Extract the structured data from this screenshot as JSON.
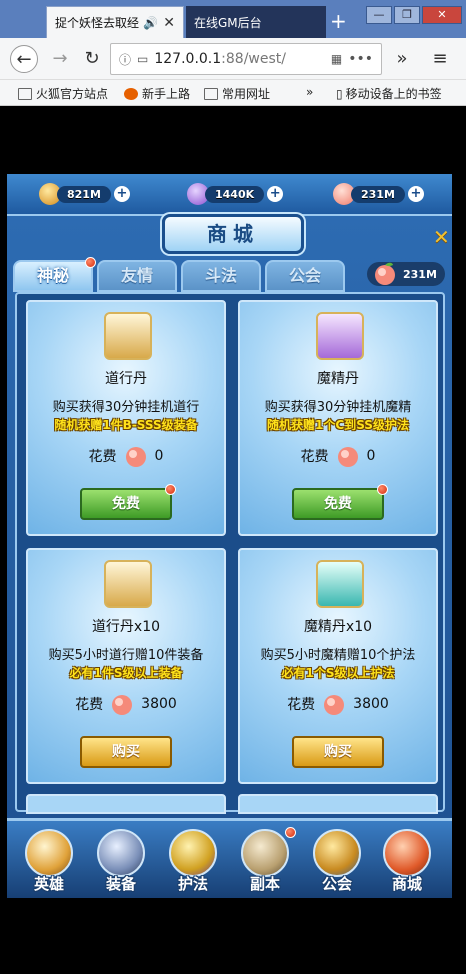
{
  "browser": {
    "tabs": [
      {
        "title": "捉个妖怪去取经"
      },
      {
        "title": "在线GM后台"
      }
    ],
    "address": {
      "host": "127.0.0.1",
      "path": ":88/west/"
    },
    "bookmarks": [
      "火狐官方站点",
      "新手上路",
      "常用网址",
      "移动设备上的书签"
    ]
  },
  "game": {
    "resources": [
      {
        "icon": "gold-ingot-icon",
        "value": "821M"
      },
      {
        "icon": "crystal-icon",
        "value": "1440K"
      },
      {
        "icon": "peach-icon",
        "value": "231M"
      }
    ],
    "shop_title": "商城",
    "shop_currency": "231M",
    "tabs": [
      "神秘",
      "友情",
      "斗法",
      "公会"
    ],
    "cards": [
      {
        "name": "道行丹",
        "desc": "购买获得30分钟挂机道行",
        "bonus": "随机获赠1件B-SSS级装备",
        "cost_label": "花费",
        "cost": "0",
        "button": "免费"
      },
      {
        "name": "魔精丹",
        "desc": "购买获得30分钟挂机魔精",
        "bonus": "随机获赠1个C到SS级护法",
        "cost_label": "花费",
        "cost": "0",
        "button": "免费"
      },
      {
        "name": "道行丹x10",
        "desc": "购买5小时道行赠10件装备",
        "bonus": "必有1件S级以上装备",
        "cost_label": "花费",
        "cost": "3800",
        "button": "购买"
      },
      {
        "name": "魔精丹x10",
        "desc": "购买5小时魔精赠10个护法",
        "bonus": "必有1个S级以上护法",
        "cost_label": "花费",
        "cost": "3800",
        "button": "购买"
      }
    ],
    "bottom_nav": [
      "英雄",
      "装备",
      "护法",
      "副本",
      "公会",
      "商城"
    ]
  }
}
